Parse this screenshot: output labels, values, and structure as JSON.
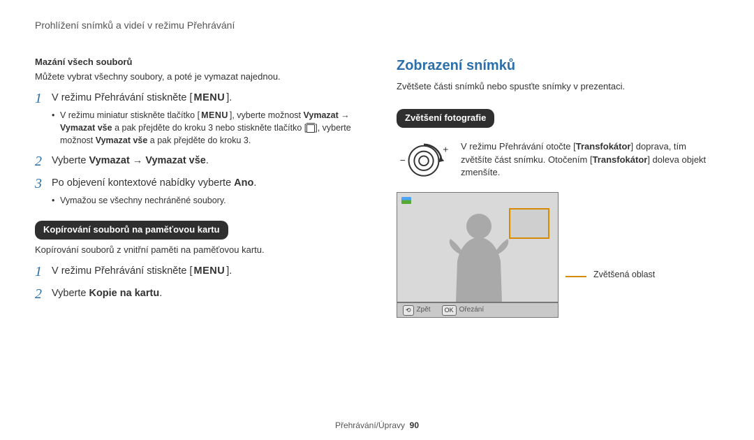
{
  "header": {
    "breadcrumb": "Prohlížení snímků a videí v režimu Přehrávání"
  },
  "left": {
    "sec1_title": "Mazání všech souborů",
    "sec1_text": "Můžete vybrat všechny soubory, a poté je vymazat najednou.",
    "step1_num": "1",
    "step1_pre": "V režimu Přehrávání stiskněte [",
    "step1_menu": "MENU",
    "step1_post": "].",
    "sub1a_pre": "V režimu miniatur stiskněte tlačítko [",
    "sub1a_menu": "MENU",
    "sub1a_mid": "], vyberte možnost ",
    "sub1a_b1": "Vymazat",
    "sub1a_arrow": " → ",
    "sub1a_b2": "Vymazat vše",
    "sub1a_mid2": " a pak přejděte do kroku 3 nebo stiskněte tlačítko [",
    "sub1a_post": "], vyberte možnost ",
    "sub1a_b3": "Vymazat vše",
    "sub1a_tail": " a pak přejděte do kroku 3.",
    "step2_num": "2",
    "step2_text_pre": "Vyberte ",
    "step2_b1": "Vymazat",
    "step2_arrow": " → ",
    "step2_b2": "Vymazat vše",
    "step2_post": ".",
    "step3_num": "3",
    "step3_text_pre": "Po objevení kontextové nabídky vyberte ",
    "step3_b1": "Ano",
    "step3_post": ".",
    "sub3a": "Vymažou se všechny nechráněné soubory.",
    "pill": "Kopírování souborů na paměťovou kartu",
    "sec2_text": "Kopírování souborů z vnitřní paměti na paměťovou kartu.",
    "cstep1_num": "1",
    "cstep1_pre": "V režimu Přehrávání stiskněte [",
    "cstep1_menu": "MENU",
    "cstep1_post": "].",
    "cstep2_num": "2",
    "cstep2_pre": "Vyberte ",
    "cstep2_b1": "Kopie na kartu",
    "cstep2_post": "."
  },
  "right": {
    "h2": "Zobrazení snímků",
    "intro": "Zvětšete části snímků nebo spusťte snímky v prezentaci.",
    "pill": "Zvětšení fotografie",
    "zoom_pre": "V režimu Přehrávání otočte [",
    "zoom_b1": "Transfokátor",
    "zoom_mid": "] doprava, tím zvětšíte část snímku. Otočením [",
    "zoom_b2": "Transfokátor",
    "zoom_post": "] doleva objekt zmenšíte.",
    "caption": "Zvětšená oblast",
    "bar_back_btn": "⟲",
    "bar_back": "Zpět",
    "bar_ok_btn": "OK",
    "bar_ok": "Ořezání"
  },
  "footer": {
    "section": "Přehrávání/Úpravy",
    "page": "90"
  }
}
